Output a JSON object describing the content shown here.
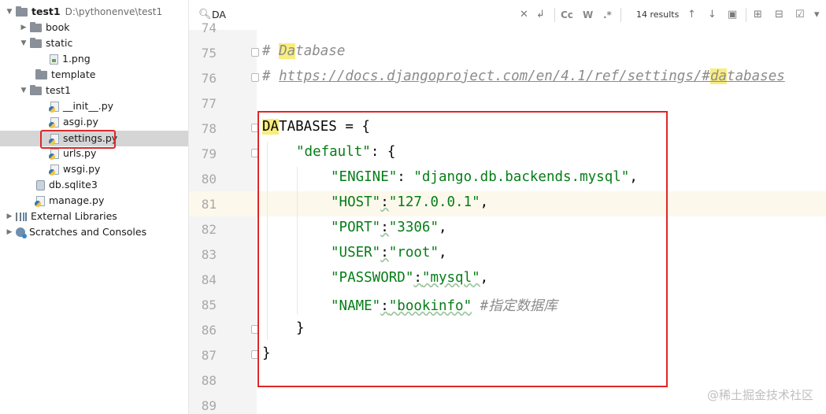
{
  "project_tree": {
    "root": {
      "name": "test1",
      "path": "D:\\pythonenve\\test1"
    },
    "items": [
      {
        "label": "book"
      },
      {
        "label": "static"
      },
      {
        "label": "1.png"
      },
      {
        "label": "template"
      },
      {
        "label": "test1"
      },
      {
        "label": "__init__.py"
      },
      {
        "label": "asgi.py"
      },
      {
        "label": "settings.py"
      },
      {
        "label": "urls.py"
      },
      {
        "label": "wsgi.py"
      },
      {
        "label": "db.sqlite3"
      },
      {
        "label": "manage.py"
      },
      {
        "label": "External Libraries"
      },
      {
        "label": "Scratches and Consoles"
      }
    ],
    "selected": "settings.py"
  },
  "search": {
    "query": "DA",
    "match_case_label": "Cc",
    "words_label": "W",
    "regex_label": ".*",
    "results": "14 results"
  },
  "editor": {
    "line_numbers": [
      "74",
      "75",
      "76",
      "77",
      "78",
      "79",
      "80",
      "81",
      "82",
      "83",
      "84",
      "85",
      "86",
      "87",
      "88",
      "89"
    ],
    "current_line": "81",
    "code": {
      "l75_hash": "# ",
      "l75_match": "Da",
      "l75_rest": "tabase",
      "l76_hash": "# ",
      "l76_url": "https://docs.djangoproject.com/en/4.1/ref/settings/#",
      "l76_match": "da",
      "l76_rest": "tabases",
      "l78_match": "DA",
      "l78_rest": "TABASES = {",
      "l79_key": "\"default\"",
      "l79_rest": ": {",
      "l80_key": "\"ENGINE\"",
      "l80_sep": ": ",
      "l80_val": "\"django.db.backends.mysql\"",
      "l80_end": ",",
      "l81_key": "\"HOST\"",
      "l81_sep": ":",
      "l81_val": "\"127.0.0.1\"",
      "l81_end": ",",
      "l82_key": "\"PORT\"",
      "l82_sep": ":",
      "l82_val": "\"3306\"",
      "l82_end": ",",
      "l83_key": "\"USER\"",
      "l83_sep": ":",
      "l83_val": "\"root\"",
      "l83_end": ",",
      "l84_key": "\"PASSWORD\"",
      "l84_sep": ":",
      "l84_val": "\"mysql\"",
      "l84_end": ",",
      "l85_key": "\"NAME\"",
      "l85_sep": ":",
      "l85_val": "\"bookinfo\"",
      "l85_comment": " #指定数据库",
      "l86": "}",
      "l87": "}"
    }
  },
  "watermark": "@稀土掘金技术社区",
  "colors": {
    "annotation_box": "#e02626",
    "search_match": "#f8ed7e",
    "string": "#067d17"
  }
}
